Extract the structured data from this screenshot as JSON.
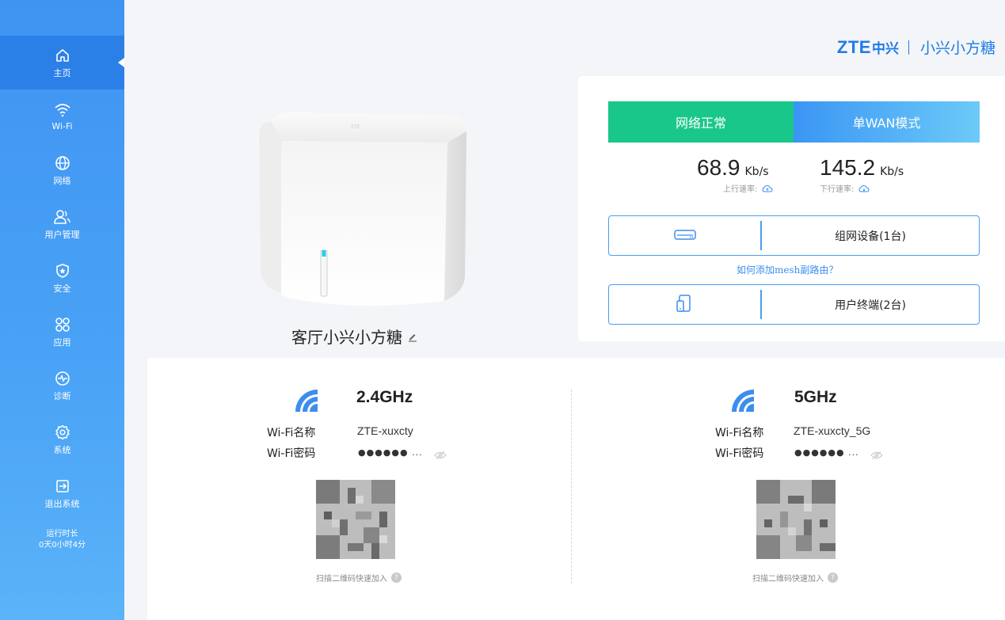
{
  "sidebar": {
    "items": [
      {
        "label": "主页",
        "icon": "home-icon"
      },
      {
        "label": "Wi-Fi",
        "icon": "wifi-icon"
      },
      {
        "label": "网络",
        "icon": "globe-icon"
      },
      {
        "label": "用户管理",
        "icon": "users-icon"
      },
      {
        "label": "安全",
        "icon": "shield-icon"
      },
      {
        "label": "应用",
        "icon": "apps-icon"
      },
      {
        "label": "诊断",
        "icon": "diagnosis-icon"
      },
      {
        "label": "系统",
        "icon": "gear-icon"
      },
      {
        "label": "退出系统",
        "icon": "logout-icon"
      }
    ],
    "runtime_label": "运行时长",
    "runtime_value": "0天0小时4分"
  },
  "brand": {
    "zte": "ZTE",
    "zhong": "中兴",
    "product": "小兴小方糖"
  },
  "device": {
    "name": "客厅小兴小方糖"
  },
  "status": {
    "network": "网络正常",
    "mode": "单WAN模式",
    "upload_value": "68.9",
    "upload_unit": "Kb/s",
    "upload_label": "上行速率:",
    "download_value": "145.2",
    "download_unit": "Kb/s",
    "download_label": "下行速率:",
    "mesh_devices": "组网设备(1台)",
    "mesh_link": "如何添加mesh副路由？",
    "user_terminals": "用户终端(2台)"
  },
  "wifi": [
    {
      "band": "2.4GHz",
      "name_label": "Wi-Fi名称",
      "name": "ZTE-xuxcty",
      "pwd_label": "Wi-Fi密码",
      "pwd": "●●●●●● ...",
      "qr_hint": "扫描二维码快速加入"
    },
    {
      "band": "5GHz",
      "name_label": "Wi-Fi名称",
      "name": "ZTE-xuxcty_5G",
      "pwd_label": "Wi-Fi密码",
      "pwd": "●●●●●● ...",
      "qr_hint": "扫描二维码快速加入"
    }
  ],
  "colors": {
    "sidebar": "#3f93f2",
    "ok": "#1ac78b",
    "accent": "#3b8ef0"
  }
}
